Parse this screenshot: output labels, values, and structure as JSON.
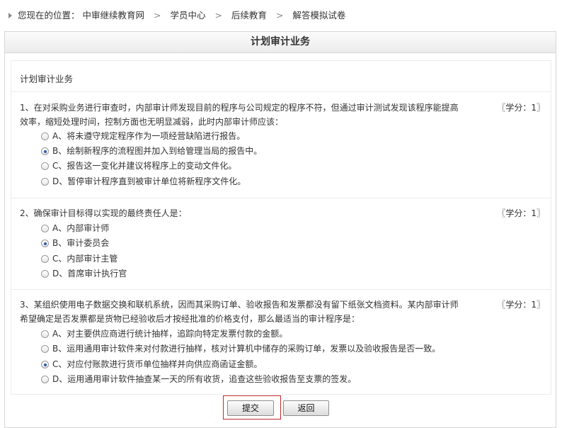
{
  "breadcrumb": {
    "prefix": "您现在的位置：",
    "items": [
      "中审继续教育网",
      "学员中心",
      "后续教育",
      "解答模拟试卷"
    ],
    "separator": ">"
  },
  "panel": {
    "title": "计划审计业务",
    "section_title": "计划审计业务"
  },
  "questions": [
    {
      "text": "1、在对采购业务进行审查时，内部审计师发现目前的程序与公司规定的程序不符，但通过审计测试发现该程序能提高效率，缩短处理时间，控制方面也无明显减弱，此时内部审计师应该：",
      "credit": "〖学分：1〗",
      "selected": 1,
      "options": [
        "A、将未遵守规定程序作为一项经营缺陷进行报告。",
        "B、绘制新程序的流程图并加入到给管理当局的报告中。",
        "C、报告这一变化并建议将程序上的变动文件化。",
        "D、暂停审计程序直到被审计单位将新程序文件化。"
      ]
    },
    {
      "text": "2、确保审计目标得以实现的最终责任人是：",
      "credit": "〖学分：1〗",
      "selected": 1,
      "options": [
        "A、内部审计师",
        "B、审计委员会",
        "C、内部审计主管",
        "D、首席审计执行官"
      ]
    },
    {
      "text": "3、某组织使用电子数据交换和联机系统，因而其采购订单、验收报告和发票都没有留下纸张文档资料。某内部审计师希望确定是否发票都是货物已经验收后才按经批准的价格支付，那么最适当的审计程序是：",
      "credit": "〖学分：1〗",
      "selected": 2,
      "options": [
        "A、对主要供应商进行统计抽样，追踪向特定发票付款的金额。",
        "B、运用通用审计软件来对付款进行抽样，核对计算机中储存的采购订单，发票以及验收报告是否一致。",
        "C、对应付账款进行货币单位抽样并向供应商函证金额。",
        "D、运用通用审计软件抽查某一天的所有收货，追查这些验收报告至支票的签发。"
      ]
    }
  ],
  "buttons": {
    "submit": "提交",
    "back": "返回"
  }
}
